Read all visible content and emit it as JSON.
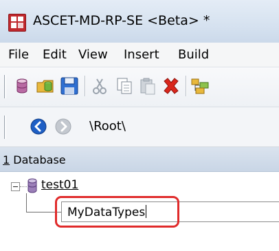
{
  "window": {
    "title": "ASCET-MD-RP-SE <Beta> *",
    "icon": "ascet-app-icon"
  },
  "menu": {
    "items": [
      "File",
      "Edit",
      "View",
      "Insert",
      "Build"
    ]
  },
  "toolbar": {
    "buttons": [
      "new-database-icon",
      "open-database-icon",
      "save-icon",
      "cut-icon",
      "copy-icon",
      "paste-icon",
      "delete-icon",
      "insert-folder-icon"
    ]
  },
  "navigation": {
    "back_icon": "back-arrow-icon",
    "forward_icon": "forward-arrow-icon",
    "path": "\\Root\\"
  },
  "panel": {
    "hotkey": "1",
    "title": " Database"
  },
  "tree": {
    "root_label": "test01",
    "editing_value": "MyDataTypes"
  },
  "colors": {
    "highlight": "#e02a2a",
    "title_bar": "#d6e2f0",
    "panel_header": "#c9d6e6",
    "back_button": "#1e5fc5"
  }
}
